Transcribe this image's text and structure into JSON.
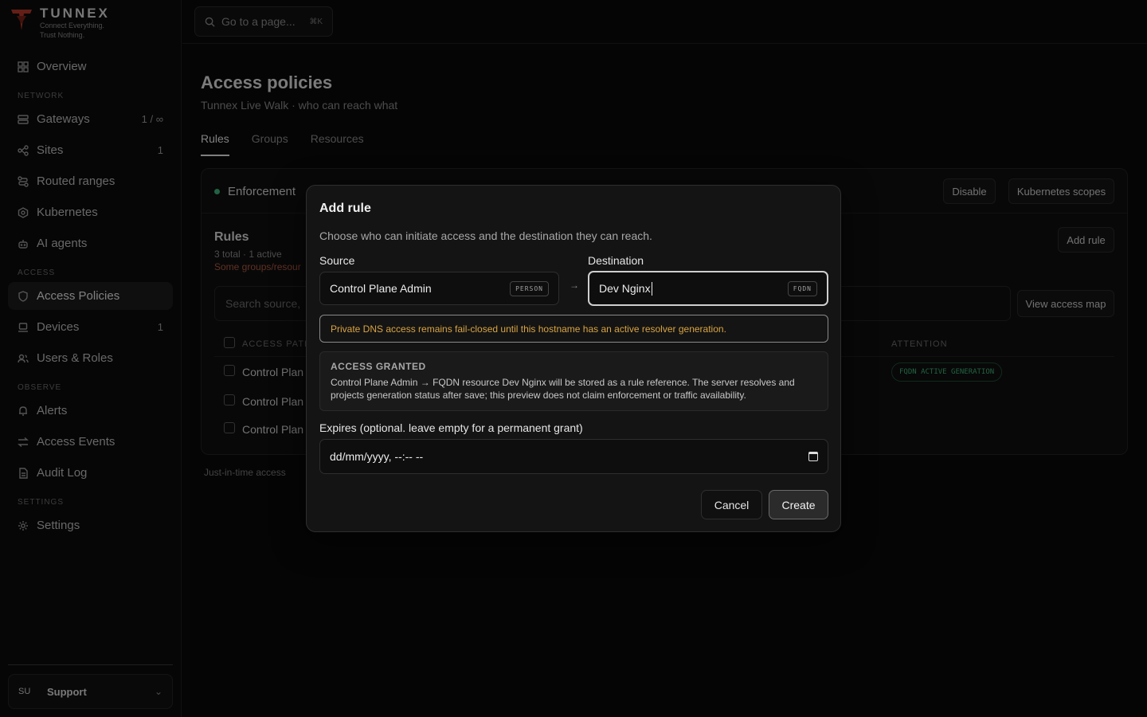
{
  "brand": {
    "name": "TUNNEX",
    "tagline_1": "Connect Everything.",
    "tagline_2": "Trust Nothing."
  },
  "sidebar": {
    "items": [
      {
        "label": "Overview",
        "icon": "grid-icon"
      },
      {
        "label": "Gateways",
        "count": "1 / ∞",
        "icon": "server-icon"
      },
      {
        "label": "Sites",
        "count": "1",
        "icon": "network-icon"
      },
      {
        "label": "Routed ranges",
        "icon": "route-icon"
      },
      {
        "label": "Kubernetes",
        "icon": "kubernetes-icon"
      },
      {
        "label": "AI agents",
        "icon": "bot-icon"
      },
      {
        "label": "Access Policies",
        "icon": "shield-icon",
        "active": true
      },
      {
        "label": "Devices",
        "count": "1",
        "icon": "laptop-icon"
      },
      {
        "label": "Users & Roles",
        "icon": "users-icon"
      },
      {
        "label": "Alerts",
        "icon": "bell-icon"
      },
      {
        "label": "Access Events",
        "icon": "swap-icon"
      },
      {
        "label": "Audit Log",
        "icon": "file-icon"
      },
      {
        "label": "Settings",
        "icon": "gear-icon"
      }
    ],
    "sections": {
      "network": "NETWORK",
      "access": "ACCESS",
      "observe": "OBSERVE",
      "settings": "SETTINGS"
    },
    "user": {
      "initials": "SU",
      "name": "Support"
    }
  },
  "topbar": {
    "search_placeholder": "Go to a page...",
    "shortcut": "⌘K"
  },
  "page": {
    "title": "Access policies",
    "subtitle": "Tunnex Live Walk · who can reach what",
    "tabs": [
      "Rules",
      "Groups",
      "Resources"
    ],
    "enforcement_label": "Enforcement",
    "disable_label": "Disable",
    "k8s_scopes_label": "Kubernetes scopes",
    "rules_heading": "Rules",
    "rules_meta": "3 total · 1 active",
    "rules_warning": "Some groups/resour",
    "add_rule_label": "Add rule",
    "search_placeholder": "Search source,",
    "view_map_label": "View access map",
    "col_access_path": "ACCESS PATH",
    "col_attention": "ATTENTION",
    "rows": [
      "Control Plan",
      "Control Plan",
      "Control Plan"
    ],
    "attention_badge": "FQDN ACTIVE GENERATION",
    "jit_note": "Just-in-time access"
  },
  "modal": {
    "title": "Add rule",
    "description": "Choose who can initiate access and the destination they can reach.",
    "source_label": "Source",
    "source_value": "Control Plane Admin",
    "source_tag": "PERSON",
    "destination_label": "Destination",
    "destination_value": "Dev Nginx",
    "destination_tag": "FQDN",
    "warning": "Private DNS access remains fail-closed until this hostname has an active resolver generation.",
    "grant_heading": "ACCESS GRANTED",
    "grant_text": "Control Plane Admin → FQDN resource Dev Nginx will be stored as a rule reference. The server resolves and projects generation status after save; this preview does not claim enforcement or traffic availability.",
    "expires_label": "Expires (optional. leave empty for a permanent grant)",
    "expires_placeholder": "dd/mm/yyyy, --:-- --",
    "cancel_label": "Cancel",
    "create_label": "Create"
  }
}
